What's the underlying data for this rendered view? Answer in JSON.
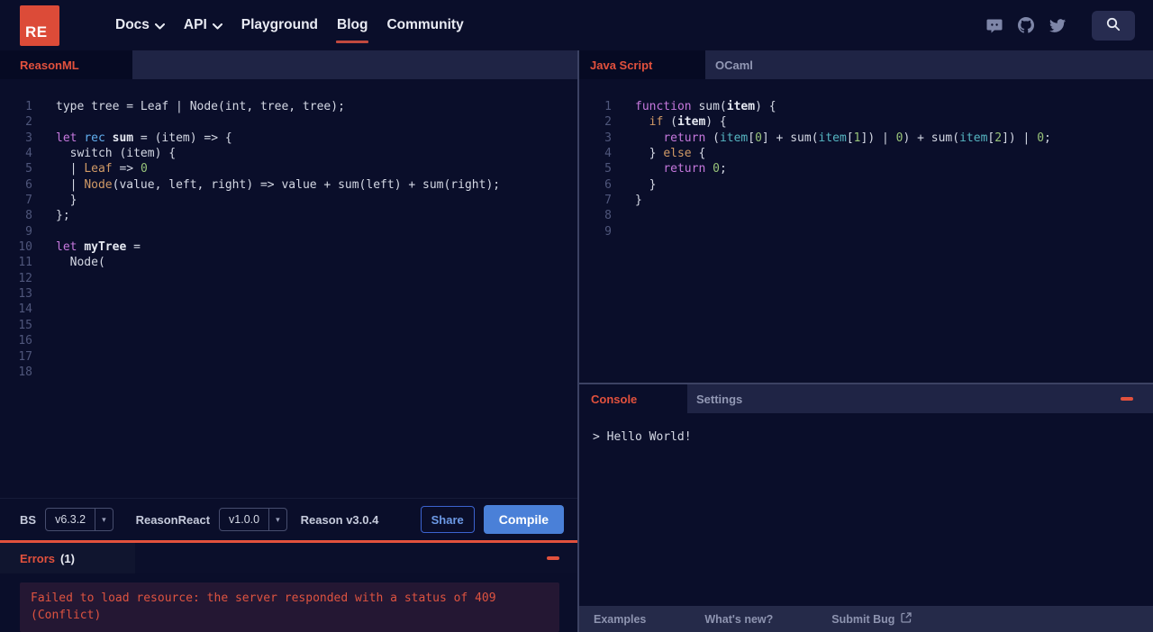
{
  "colors": {
    "accent": "#e2513d",
    "logo_bg": "#dc4b38",
    "compile_blue": "#4a80d8"
  },
  "navbar": {
    "logo_text": "RE",
    "items": [
      {
        "label": "Docs",
        "chevron": true,
        "active": false
      },
      {
        "label": "API",
        "chevron": true,
        "active": false
      },
      {
        "label": "Playground",
        "chevron": false,
        "active": false
      },
      {
        "label": "Blog",
        "chevron": false,
        "active": true
      },
      {
        "label": "Community",
        "chevron": false,
        "active": false
      }
    ],
    "icons": [
      "discord",
      "github",
      "twitter",
      "search"
    ]
  },
  "left_panel": {
    "tab_label": "ReasonML",
    "code": [
      [
        [
          "plain",
          "type tree = Leaf | Node(int, tree, tree);"
        ]
      ],
      [],
      [
        [
          "kw",
          "let"
        ],
        [
          "plain",
          " "
        ],
        [
          "blue",
          "rec"
        ],
        [
          "plain",
          " "
        ],
        [
          "bold",
          "sum"
        ],
        [
          "plain",
          " = (item) => {"
        ]
      ],
      [
        [
          "plain",
          "  switch (item) {"
        ]
      ],
      [
        [
          "plain",
          "  | "
        ],
        [
          "orange",
          "Leaf"
        ],
        [
          "plain",
          " => "
        ],
        [
          "num",
          "0"
        ]
      ],
      [
        [
          "plain",
          "  | "
        ],
        [
          "orange",
          "Node"
        ],
        [
          "plain",
          "(value, left, right) => value + sum(left) + sum(right);"
        ]
      ],
      [
        [
          "plain",
          "  }"
        ]
      ],
      [
        [
          "plain",
          "};"
        ]
      ],
      [],
      [
        [
          "kw",
          "let"
        ],
        [
          "plain",
          " "
        ],
        [
          "bold",
          "myTree"
        ],
        [
          "plain",
          " ="
        ]
      ],
      [
        [
          "plain",
          "  Node("
        ]
      ],
      [],
      [],
      [],
      [],
      [],
      [],
      []
    ],
    "toolbar": {
      "bs_label": "BS",
      "bs_version": "v6.3.2",
      "reasonreact_label": "ReasonReact",
      "reasonreact_version": "v1.0.0",
      "reason_version": "Reason v3.0.4",
      "share_label": "Share",
      "compile_label": "Compile"
    },
    "errors": {
      "title": "Errors",
      "count": "(1)",
      "message": "Failed to load resource: the server responded with a status of 409 (Conflict)"
    }
  },
  "right_panel": {
    "tab_js": "Java Script",
    "tab_ocaml": "OCaml",
    "code": [
      [
        [
          "kw",
          "function"
        ],
        [
          "plain",
          " sum("
        ],
        [
          "bold",
          "item"
        ],
        [
          "plain",
          ") {"
        ]
      ],
      [
        [
          "plain",
          "  "
        ],
        [
          "orange",
          "if"
        ],
        [
          "plain",
          " ("
        ],
        [
          "bold",
          "item"
        ],
        [
          "plain",
          ") {"
        ]
      ],
      [
        [
          "plain",
          "    "
        ],
        [
          "kw",
          "return"
        ],
        [
          "plain",
          " ("
        ],
        [
          "cyan",
          "item"
        ],
        [
          "plain",
          "["
        ],
        [
          "num",
          "0"
        ],
        [
          "plain",
          "] + sum("
        ],
        [
          "cyan",
          "item"
        ],
        [
          "plain",
          "["
        ],
        [
          "num",
          "1"
        ],
        [
          "plain",
          "]) | "
        ],
        [
          "num",
          "0"
        ],
        [
          "plain",
          ") + sum("
        ],
        [
          "cyan",
          "item"
        ],
        [
          "plain",
          "["
        ],
        [
          "num",
          "2"
        ],
        [
          "plain",
          "]) | "
        ],
        [
          "num",
          "0"
        ],
        [
          "plain",
          ";"
        ]
      ],
      [
        [
          "plain",
          "  } "
        ],
        [
          "orange",
          "else"
        ],
        [
          "plain",
          " {"
        ]
      ],
      [
        [
          "plain",
          "    "
        ],
        [
          "kw",
          "return"
        ],
        [
          "plain",
          " "
        ],
        [
          "num",
          "0"
        ],
        [
          "plain",
          ";"
        ]
      ],
      [
        [
          "plain",
          "  }"
        ]
      ],
      [
        [
          "plain",
          "}"
        ]
      ],
      [],
      []
    ],
    "console": {
      "tab_label": "Console",
      "settings_label": "Settings",
      "output": "> Hello World!"
    },
    "footer": {
      "examples": "Examples",
      "whats_new": "What's new?",
      "submit_bug": "Submit Bug"
    }
  }
}
